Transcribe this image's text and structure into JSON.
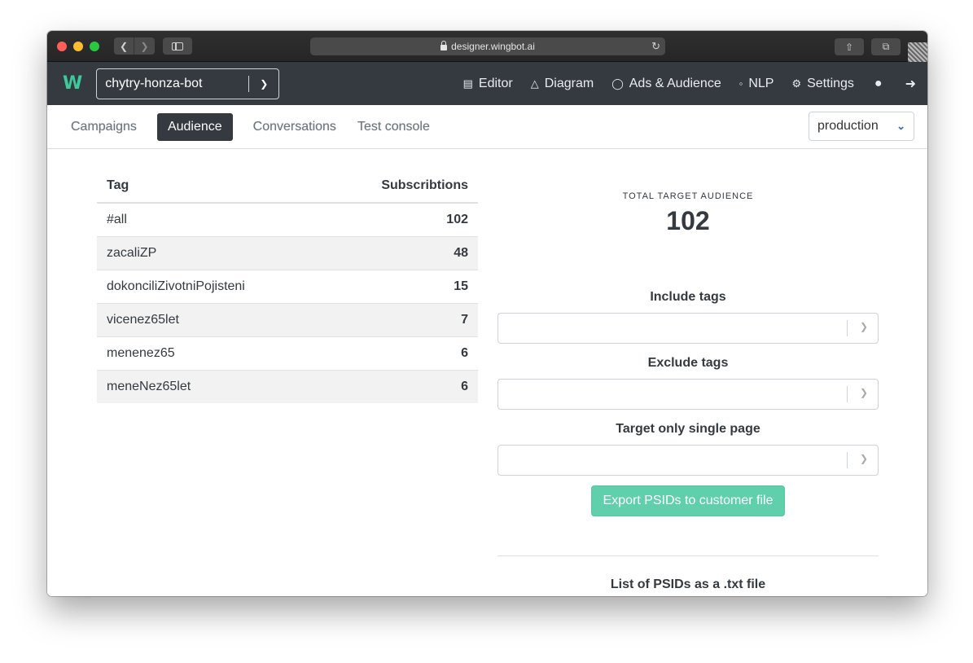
{
  "browser": {
    "url": "designer.wingbot.ai"
  },
  "app": {
    "logo_text": "W",
    "bot_name": "chytry-honza-bot",
    "nav": {
      "editor": "Editor",
      "diagram": "Diagram",
      "ads": "Ads & Audience",
      "nlp": "NLP",
      "settings": "Settings"
    }
  },
  "tabs": {
    "campaigns": "Campaigns",
    "audience": "Audience",
    "conversations": "Conversations",
    "test_console": "Test console"
  },
  "environment": "production",
  "table": {
    "headers": {
      "tag": "Tag",
      "subscriptions": "Subscribtions"
    },
    "rows": [
      {
        "tag": "#all",
        "count": "102"
      },
      {
        "tag": "zacaliZP",
        "count": "48"
      },
      {
        "tag": "dokonciliZivotniPojisteni",
        "count": "15"
      },
      {
        "tag": "vicenez65let",
        "count": "7"
      },
      {
        "tag": "menenez65",
        "count": "6"
      },
      {
        "tag": "meneNez65let",
        "count": "6"
      }
    ]
  },
  "audience": {
    "total_label": "TOTAL TARGET AUDIENCE",
    "total_value": "102",
    "include_label": "Include tags",
    "exclude_label": "Exclude tags",
    "single_page_label": "Target only single page",
    "export_button": "Export PSIDs to customer file",
    "list_title": "List of PSIDs as a .txt file"
  },
  "colors": {
    "nav_bg": "#343a40",
    "accent": "#3ec99a",
    "export_button": "#5fcfac"
  }
}
